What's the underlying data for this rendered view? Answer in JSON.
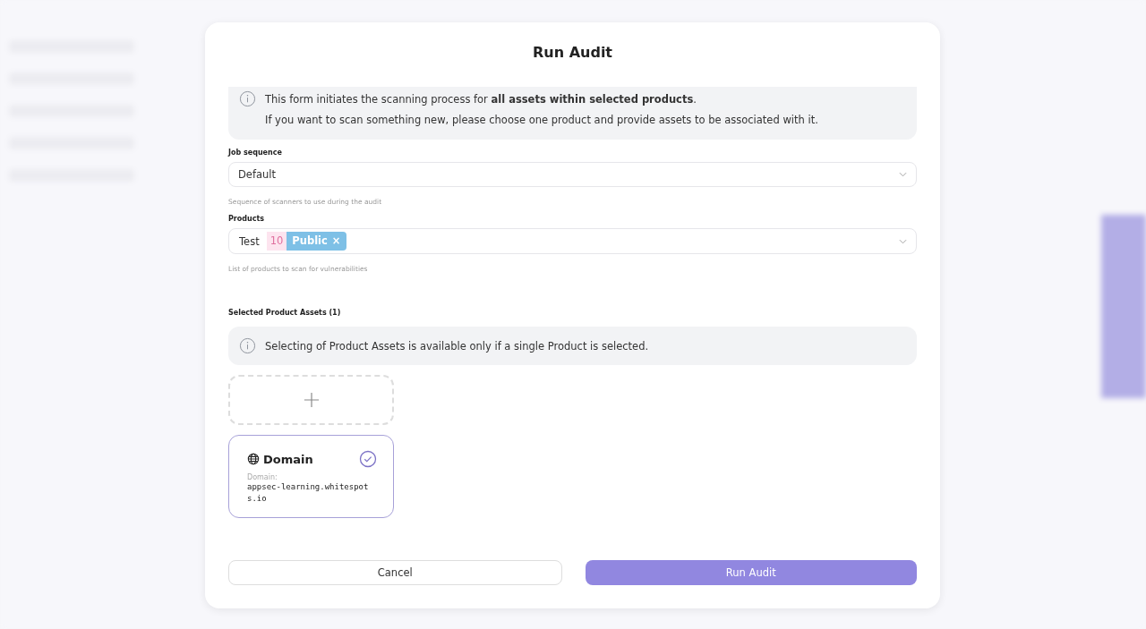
{
  "dialog": {
    "title": "Run Audit",
    "intro": {
      "lines": [
        "This form initiates the scanning process for **all assets within selected products**.",
        "If you want to scan something new, please choose one product and provide assets to be associated with it."
      ]
    },
    "job_sequence": {
      "label": "Job sequence",
      "value": "Default",
      "hint": "Sequence of scanners to use during the audit"
    },
    "products": {
      "label": "Products",
      "items": [
        {
          "name": "Test",
          "count": "10",
          "tag": "Public",
          "remove": "×"
        }
      ],
      "hint": "List of products to scan for vulnerabilities"
    },
    "assets": {
      "label": "Selected Product Assets (1)",
      "notice": "Selecting of Product Assets is available only if a single Product is selected.",
      "items": [
        {
          "type": "Domain",
          "field_label": "Domain:",
          "value": "appsec-learning.whitespots.io",
          "checked": true
        }
      ]
    },
    "buttons": [
      {
        "label": "Cancel",
        "kind": "secondary"
      },
      {
        "label": "Run Audit",
        "kind": "primary"
      }
    ]
  }
}
